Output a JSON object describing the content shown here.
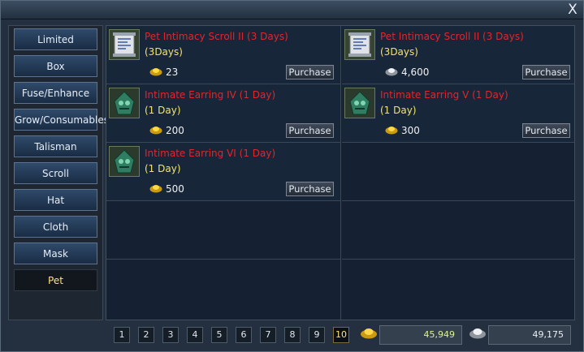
{
  "window": {
    "close_label": "X"
  },
  "categories": [
    {
      "label": "Limited",
      "active": false
    },
    {
      "label": "Box",
      "active": false
    },
    {
      "label": "Fuse/Enhance",
      "active": false
    },
    {
      "label": "Grow/Consumables",
      "active": false
    },
    {
      "label": "Talisman",
      "active": false
    },
    {
      "label": "Scroll",
      "active": false
    },
    {
      "label": "Hat",
      "active": false
    },
    {
      "label": "Cloth",
      "active": false
    },
    {
      "label": "Mask",
      "active": false
    },
    {
      "label": "Pet",
      "active": true
    }
  ],
  "items": [
    {
      "name": "Pet Intimacy Scroll II (3 Days)",
      "duration": "(3Days)",
      "price": "23",
      "currency": "gold",
      "icon": "scroll-icon",
      "button": "Purchase"
    },
    {
      "name": "Pet Intimacy Scroll II (3 Days)",
      "duration": "(3Days)",
      "price": "4,600",
      "currency": "silver",
      "icon": "scroll-icon",
      "button": "Purchase"
    },
    {
      "name": "Intimate Earring IV (1 Day)",
      "duration": "(1 Day)",
      "price": "200",
      "currency": "gold",
      "icon": "earring-icon",
      "button": "Purchase"
    },
    {
      "name": "Intimate Earring V (1 Day)",
      "duration": "(1 Day)",
      "price": "300",
      "currency": "gold",
      "icon": "earring-icon",
      "button": "Purchase"
    },
    {
      "name": "Intimate Earring VI (1 Day)",
      "duration": "(1 Day)",
      "price": "500",
      "currency": "gold",
      "icon": "earring-icon",
      "button": "Purchase"
    }
  ],
  "pagination": {
    "pages": [
      "1",
      "2",
      "3",
      "4",
      "5",
      "6",
      "7",
      "8",
      "9",
      "10"
    ],
    "current": "10"
  },
  "balances": {
    "gold": "45,949",
    "silver": "49,175"
  },
  "colors": {
    "item_name": "#e0272b",
    "duration": "#f2e46a",
    "active_category": "#ffe37a",
    "gold_balance": "#d9f29a"
  }
}
